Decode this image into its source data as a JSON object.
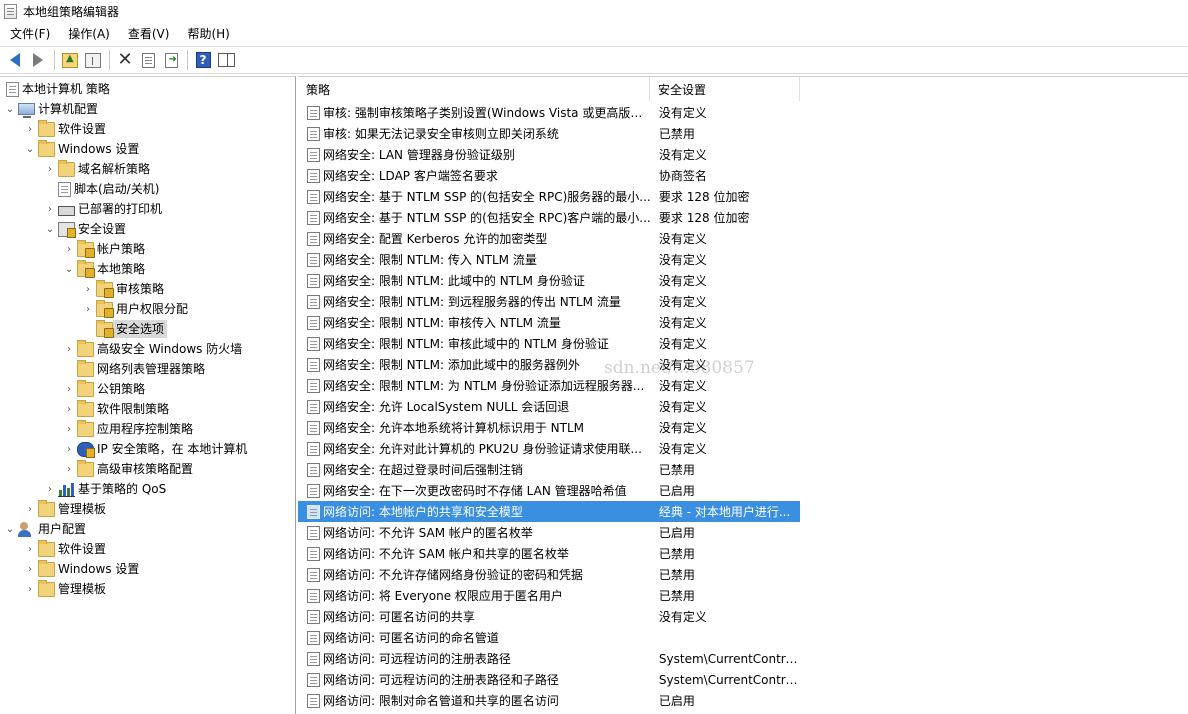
{
  "window": {
    "title": "本地组策略编辑器"
  },
  "menu": [
    "文件(F)",
    "操作(A)",
    "查看(V)",
    "帮助(H)"
  ],
  "toolbar": {
    "icons": [
      "back-arrow-icon",
      "forward-arrow-icon",
      "up-folder-icon",
      "show-hide-tree-icon",
      "delete-icon",
      "properties-icon",
      "export-list-icon",
      "help-icon",
      "action-pane-icon"
    ]
  },
  "tree": {
    "root": "本地计算机 策略",
    "computer_config": "计算机配置",
    "software_settings": "软件设置",
    "windows_settings": "Windows 设置",
    "name_resolution": "域名解析策略",
    "scripts": "脚本(启动/关机)",
    "printers": "已部署的打印机",
    "security_settings": "安全设置",
    "account_policies": "帐户策略",
    "local_policies": "本地策略",
    "audit_policy": "审核策略",
    "user_rights": "用户权限分配",
    "security_options": "安全选项",
    "firewall": "高级安全 Windows 防火墙",
    "network_list": "网络列表管理器策略",
    "public_key": "公钥策略",
    "software_restriction": "软件限制策略",
    "app_control": "应用程序控制策略",
    "ipsec": "IP 安全策略，在 本地计算机",
    "advanced_audit": "高级审核策略配置",
    "qos": "基于策略的 QoS",
    "admin_templates": "管理模板",
    "user_config": "用户配置",
    "user_software": "软件设置",
    "user_windows": "Windows 设置",
    "user_admin_templates": "管理模板"
  },
  "list": {
    "col_policy": "策略",
    "col_setting": "安全设置",
    "rows": [
      {
        "policy": "审核: 强制审核策略子类别设置(Windows Vista 或更高版本...",
        "setting": "没有定义"
      },
      {
        "policy": "审核: 如果无法记录安全审核则立即关闭系统",
        "setting": "已禁用"
      },
      {
        "policy": "网络安全: LAN 管理器身份验证级别",
        "setting": "没有定义"
      },
      {
        "policy": "网络安全: LDAP 客户端签名要求",
        "setting": "协商签名"
      },
      {
        "policy": "网络安全: 基于 NTLM SSP 的(包括安全 RPC)服务器的最小...",
        "setting": "要求 128 位加密"
      },
      {
        "policy": "网络安全: 基于 NTLM SSP 的(包括安全 RPC)客户端的最小...",
        "setting": "要求 128 位加密"
      },
      {
        "policy": "网络安全: 配置 Kerberos 允许的加密类型",
        "setting": "没有定义"
      },
      {
        "policy": "网络安全: 限制 NTLM: 传入 NTLM 流量",
        "setting": "没有定义"
      },
      {
        "policy": "网络安全: 限制 NTLM: 此域中的 NTLM 身份验证",
        "setting": "没有定义"
      },
      {
        "policy": "网络安全: 限制 NTLM: 到远程服务器的传出 NTLM 流量",
        "setting": "没有定义"
      },
      {
        "policy": "网络安全: 限制 NTLM: 审核传入 NTLM 流量",
        "setting": "没有定义"
      },
      {
        "policy": "网络安全: 限制 NTLM: 审核此域中的 NTLM 身份验证",
        "setting": "没有定义"
      },
      {
        "policy": "网络安全: 限制 NTLM: 添加此域中的服务器例外",
        "setting": "没有定义"
      },
      {
        "policy": "网络安全: 限制 NTLM: 为 NTLM 身份验证添加远程服务器...",
        "setting": "没有定义"
      },
      {
        "policy": "网络安全: 允许 LocalSystem NULL 会话回退",
        "setting": "没有定义"
      },
      {
        "policy": "网络安全: 允许本地系统将计算机标识用于 NTLM",
        "setting": "没有定义"
      },
      {
        "policy": "网络安全: 允许对此计算机的 PKU2U 身份验证请求使用联...",
        "setting": "没有定义"
      },
      {
        "policy": "网络安全: 在超过登录时间后强制注销",
        "setting": "已禁用"
      },
      {
        "policy": "网络安全: 在下一次更改密码时不存储 LAN 管理器哈希值",
        "setting": "已启用"
      },
      {
        "policy": "网络访问: 本地帐户的共享和安全模型",
        "setting": "经典 - 对本地用户进行..."
      },
      {
        "policy": "网络访问: 不允许 SAM 帐户的匿名枚举",
        "setting": "已启用"
      },
      {
        "policy": "网络访问: 不允许 SAM 帐户和共享的匿名枚举",
        "setting": "已禁用"
      },
      {
        "policy": "网络访问: 不允许存储网络身份验证的密码和凭据",
        "setting": "已禁用"
      },
      {
        "policy": "网络访问: 将 Everyone 权限应用于匿名用户",
        "setting": "已禁用"
      },
      {
        "policy": "网络访问: 可匿名访问的共享",
        "setting": "没有定义"
      },
      {
        "policy": "网络访问: 可匿名访问的命名管道",
        "setting": ""
      },
      {
        "policy": "网络访问: 可远程访问的注册表路径",
        "setting": "System\\CurrentContro..."
      },
      {
        "policy": "网络访问: 可远程访问的注册表路径和子路径",
        "setting": "System\\CurrentContro..."
      },
      {
        "policy": "网络访问: 限制对命名管道和共享的匿名访问",
        "setting": "已启用"
      }
    ],
    "selected_index": 19
  },
  "watermark": "sdn.net/...680857",
  "colors": {
    "selection": "#3b8fe0",
    "folder": "#f3d37a"
  }
}
